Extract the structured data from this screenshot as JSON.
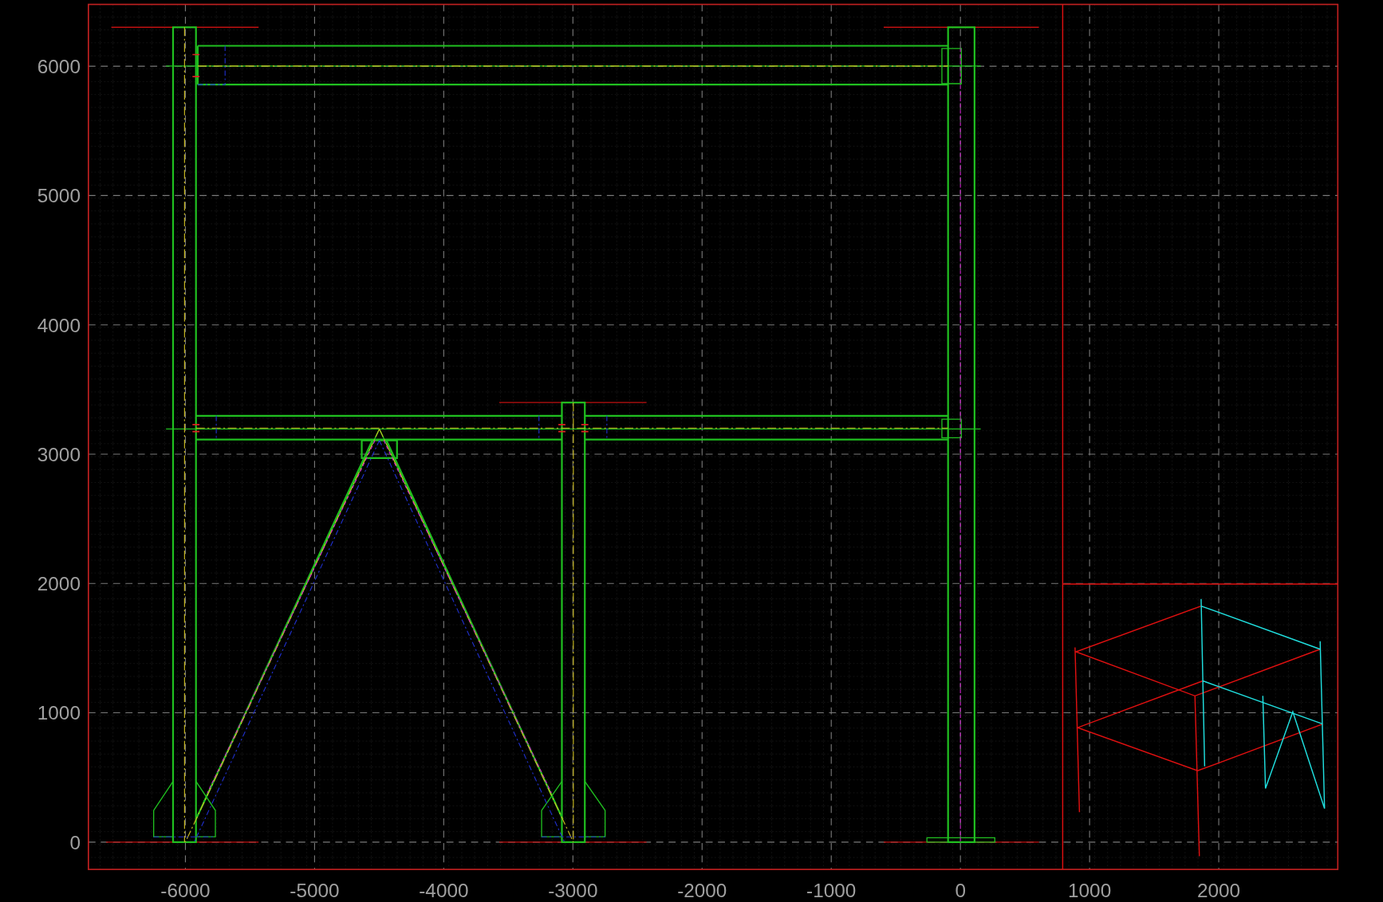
{
  "plot": {
    "x_tick_labels": [
      "-6000",
      "-5000",
      "-4000",
      "-3000",
      "-2000",
      "-1000",
      "0",
      "1000",
      "2000"
    ],
    "y_tick_labels": [
      "6000",
      "5000",
      "4000",
      "3000",
      "2000",
      "1000",
      "0"
    ]
  }
}
